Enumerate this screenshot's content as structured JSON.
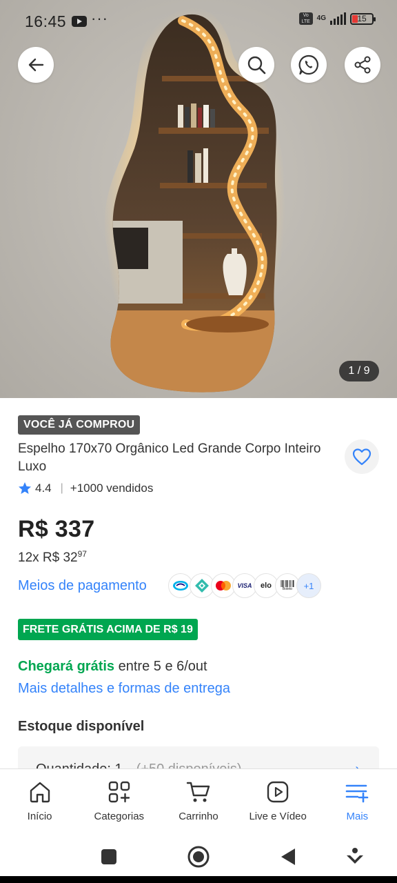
{
  "status_bar": {
    "time": "16:45",
    "dots": "···",
    "network": "4G",
    "battery": "15"
  },
  "gallery": {
    "counter": "1 / 9",
    "current": 1,
    "total": 9
  },
  "product": {
    "badge": "VOCÊ JÁ COMPROU",
    "title": "Espelho 170x70 Orgânico Led Grande Corpo Inteiro Luxo",
    "rating": "4.4",
    "sold": "+1000 vendidos",
    "price": "R$ 337",
    "installment_prefix": "12x R$ 32",
    "installment_cents": "97"
  },
  "payment": {
    "link_label": "Meios de pagamento",
    "methods": [
      "mercado-pago",
      "pix",
      "mastercard",
      "visa",
      "elo",
      "boleto"
    ],
    "visa_label": "VISA",
    "elo_label": "elo",
    "boleto_label": "Boleto",
    "more": "+1"
  },
  "shipping": {
    "badge": "FRETE GRÁTIS ACIMA DE R$ 19",
    "arrival_green": "Chegará grátis",
    "arrival_rest": " entre 5 e 6/out",
    "details_link": "Mais detalhes e formas de entrega"
  },
  "stock": {
    "title": "Estoque disponível",
    "quantity_label": "Quantidade: 1",
    "available": "(+50 disponíveis)"
  },
  "bottom_nav": {
    "items": [
      {
        "label": "Início",
        "icon": "home-icon"
      },
      {
        "label": "Categorias",
        "icon": "categories-icon"
      },
      {
        "label": "Carrinho",
        "icon": "cart-icon"
      },
      {
        "label": "Live e Vídeo",
        "icon": "play-icon"
      },
      {
        "label": "Mais",
        "icon": "menu-plus-icon"
      }
    ],
    "active": "Mais"
  },
  "colors": {
    "accent_blue": "#3483fa",
    "green": "#00a650",
    "badge_gray": "#555555",
    "star_blue": "#3483fa"
  }
}
